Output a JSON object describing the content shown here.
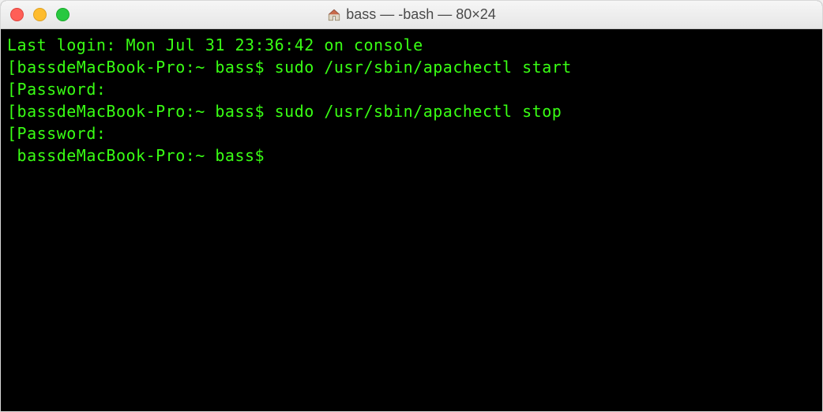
{
  "window": {
    "title": "bass — -bash — 80×24"
  },
  "terminal": {
    "lines": {
      "l0": "Last login: Mon Jul 31 23:36:42 on console",
      "l1": "[bassdeMacBook-Pro:~ bass$ sudo /usr/sbin/apachectl start",
      "l2": "[Password:",
      "l3": "[bassdeMacBook-Pro:~ bass$ sudo /usr/sbin/apachectl stop",
      "l4": "[Password:",
      "l5": " bassdeMacBook-Pro:~ bass$ "
    }
  },
  "colors": {
    "terminal_fg": "#39ff14",
    "terminal_bg": "#000000"
  }
}
